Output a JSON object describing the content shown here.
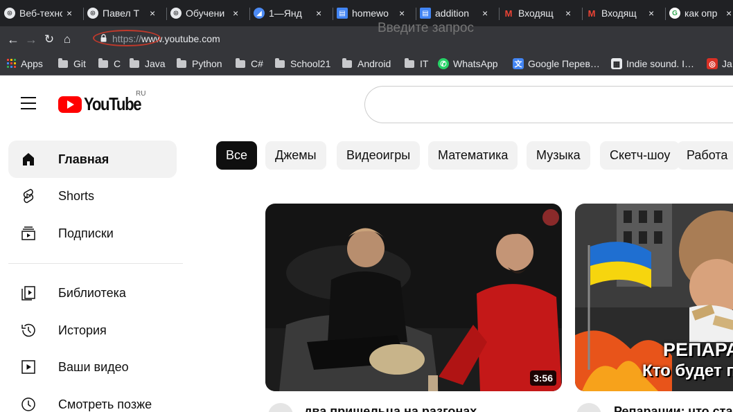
{
  "browser": {
    "tabs": [
      {
        "title": "Веб-техно",
        "color": "#e8eaed",
        "glyph": "⊛"
      },
      {
        "title": "Павел Т",
        "color": "#e8eaed",
        "glyph": "⊛"
      },
      {
        "title": "Обучени",
        "color": "#e8eaed",
        "glyph": "⊛"
      },
      {
        "title": "1—Янд",
        "color": "#4c8bf5",
        "glyph": "◢"
      },
      {
        "title": "homewo",
        "color": "#4285f4",
        "glyph": "▤"
      },
      {
        "title": "addition",
        "color": "#4285f4",
        "glyph": "▤"
      },
      {
        "title": "Входящ",
        "color": "#ea4335",
        "glyph": "M"
      },
      {
        "title": "Входящ",
        "color": "#ea4335",
        "glyph": "M"
      },
      {
        "title": "как опр",
        "color": "#34a853",
        "glyph": "G"
      }
    ],
    "tab_close": "×",
    "address": {
      "scheme": "https://",
      "host": "www.youtube.com"
    },
    "bookmarks": [
      {
        "label": "Apps",
        "kind": "apps"
      },
      {
        "label": "Git",
        "kind": "folder"
      },
      {
        "label": "C",
        "kind": "folder"
      },
      {
        "label": "Java",
        "kind": "folder"
      },
      {
        "label": "Python",
        "kind": "folder"
      },
      {
        "label": "C#",
        "kind": "folder"
      },
      {
        "label": "School21",
        "kind": "folder"
      },
      {
        "label": "Android",
        "kind": "folder"
      },
      {
        "label": "IT",
        "kind": "folder"
      },
      {
        "label": "WhatsApp",
        "kind": "whatsapp"
      },
      {
        "label": "Google Перев…",
        "kind": "translate"
      },
      {
        "label": "Indie sound. I…",
        "kind": "indie"
      },
      {
        "label": "Ja",
        "kind": "red"
      }
    ]
  },
  "youtube": {
    "logo_text": "YouTube",
    "region": "RU",
    "search_placeholder": "Введите запрос",
    "sidebar": [
      {
        "label": "Главная",
        "icon": "home-icon",
        "active": true
      },
      {
        "label": "Shorts",
        "icon": "shorts-icon",
        "active": false
      },
      {
        "label": "Подписки",
        "icon": "subscriptions-icon",
        "active": false
      },
      {
        "label": "Библиотека",
        "icon": "library-icon",
        "active": false
      },
      {
        "label": "История",
        "icon": "history-icon",
        "active": false
      },
      {
        "label": "Ваши видео",
        "icon": "your-videos-icon",
        "active": false
      },
      {
        "label": "Смотреть позже",
        "icon": "watch-later-icon",
        "active": false
      }
    ],
    "chips": [
      "Все",
      "Джемы",
      "Видеоигры",
      "Математика",
      "Музыка",
      "Скетч-шоу",
      "Работа"
    ],
    "videos": [
      {
        "title": "два пришельца на разгонах",
        "duration": "3:56"
      },
      {
        "title": "Репарации: что ста",
        "overlay_line1": "РЕПАРА",
        "overlay_line2": "Кто будет п"
      }
    ]
  }
}
